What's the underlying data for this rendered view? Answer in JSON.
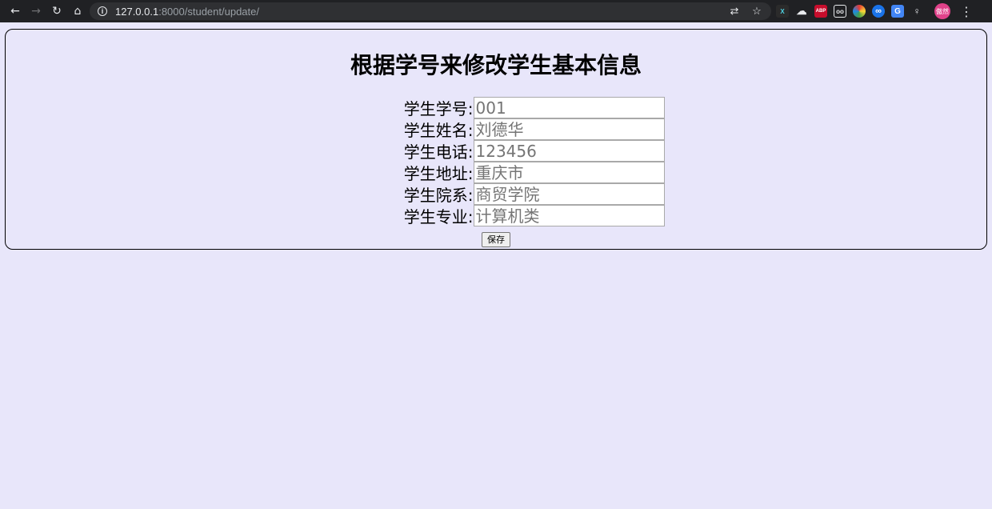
{
  "browser": {
    "url_host": "127.0.0.1",
    "url_path": ":8000/student/update/",
    "avatar_text": "傲然",
    "extensions": [
      {
        "name": "xpath-ext-icon",
        "text": "X",
        "color": "#2b2b2b"
      },
      {
        "name": "cloud-ext-icon",
        "text": "☁",
        "color": "#202124"
      },
      {
        "name": "adblock-ext-icon",
        "text": "ABP",
        "color": "#c70d2c"
      },
      {
        "name": "glasses-ext-icon",
        "text": "👓",
        "color": "#202124"
      },
      {
        "name": "color-ext-icon",
        "text": "◉",
        "color": "#e53935"
      },
      {
        "name": "infinity-ext-icon",
        "text": "∞",
        "color": "#1a73e8"
      },
      {
        "name": "translate-ext-icon",
        "text": "G",
        "color": "#4285f4"
      },
      {
        "name": "bulb-ext-icon",
        "text": "💡",
        "color": "#202124"
      }
    ]
  },
  "page": {
    "title": "根据学号来修改学生基本信息",
    "fields": [
      {
        "label": "学生学号:",
        "placeholder": "001",
        "name": "student-id-field"
      },
      {
        "label": "学生姓名:",
        "placeholder": "刘德华",
        "name": "student-name-field"
      },
      {
        "label": "学生电话:",
        "placeholder": "123456",
        "name": "student-phone-field"
      },
      {
        "label": "学生地址:",
        "placeholder": "重庆市",
        "name": "student-address-field"
      },
      {
        "label": "学生院系:",
        "placeholder": "商贸学院",
        "name": "student-department-field"
      },
      {
        "label": "学生专业:",
        "placeholder": "计算机类",
        "name": "student-major-field"
      }
    ],
    "save_label": "保存"
  },
  "colors": {
    "page_background": "#e8e6fa",
    "chrome_background": "#202124"
  }
}
